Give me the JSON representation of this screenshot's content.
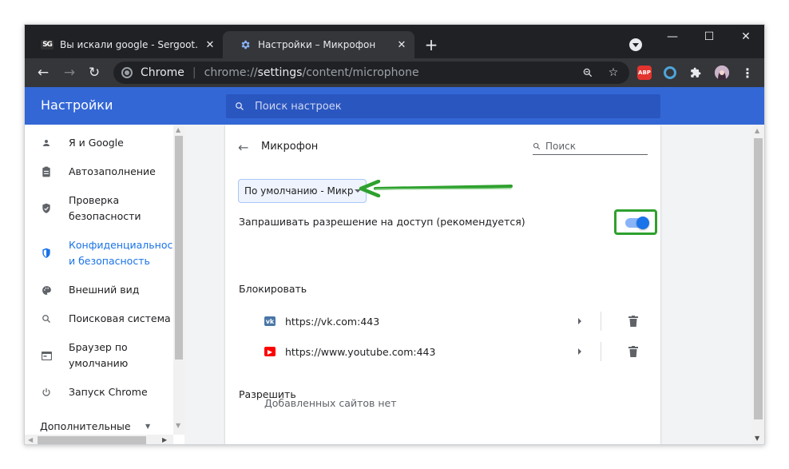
{
  "browser": {
    "tabs": [
      {
        "title": "Вы искали google - Sergoot.ru –",
        "favicon": "sg-logo-icon",
        "active": false
      },
      {
        "title": "Настройки – Микрофон",
        "favicon": "gear-icon",
        "active": true
      }
    ],
    "omnibox": {
      "site_label": "Chrome",
      "url_scheme": "chrome://",
      "url_host": "settings",
      "url_path": "/content/microphone"
    },
    "extensions": [
      {
        "name": "abp-icon",
        "label": "ABP"
      },
      {
        "name": "ring-extension-icon"
      },
      {
        "name": "puzzle-icon"
      },
      {
        "name": "profile-avatar-icon"
      }
    ]
  },
  "settings": {
    "title": "Настройки",
    "search_placeholder": "Поиск настроек",
    "sidebar": [
      {
        "label": "Я и Google",
        "icon": "person-icon"
      },
      {
        "label": "Автозаполнение",
        "icon": "clipboard-icon"
      },
      {
        "label": "Проверка безопасности",
        "icon": "shield-check-icon"
      },
      {
        "label": "Конфиденциальность и безопасность",
        "icon": "shield-icon",
        "active": true
      },
      {
        "label": "Внешний вид",
        "icon": "palette-icon"
      },
      {
        "label": "Поисковая система",
        "icon": "search-icon"
      },
      {
        "label": "Браузер по умолчанию",
        "icon": "browser-icon"
      },
      {
        "label": "Запуск Chrome",
        "icon": "power-icon"
      },
      {
        "label": "Дополнительные",
        "icon": "chevron-down-icon"
      }
    ],
    "page": {
      "title": "Микрофон",
      "search_placeholder": "Поиск",
      "device_select": "По умолчанию - Микрофон",
      "ask_label": "Запрашивать разрешение на доступ (рекомендуется)",
      "ask_enabled": true,
      "block_heading": "Блокировать",
      "blocked_sites": [
        {
          "url": "https://vk.com:443",
          "favicon": "vk-icon",
          "color": "#4a76a8"
        },
        {
          "url": "https://www.youtube.com:443",
          "favicon": "youtube-icon",
          "color": "#ff0000"
        }
      ],
      "allow_heading": "Разрешить",
      "allow_empty": "Добавленных сайтов нет"
    }
  },
  "colors": {
    "header_blue": "#3367d6",
    "accent": "#1a73e8",
    "highlight_green": "#2ea12e"
  }
}
